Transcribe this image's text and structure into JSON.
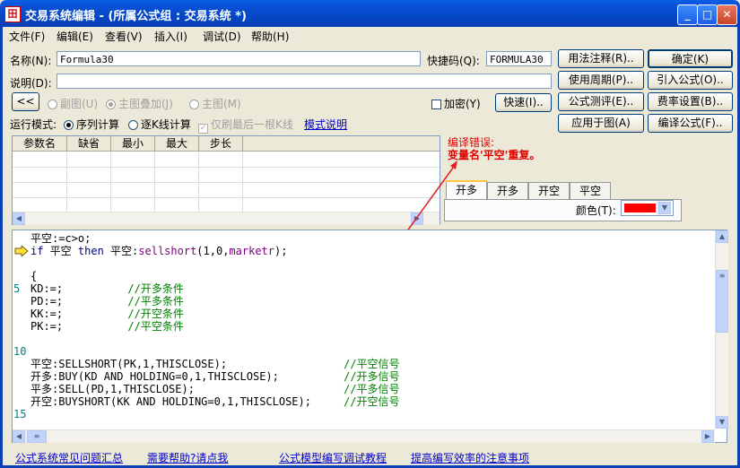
{
  "window": {
    "title": "交易系统编辑 - (所属公式组 : 交易系统 *)",
    "icon_glyph": "⽥"
  },
  "menu": [
    "文件(F)",
    "编辑(E)",
    "查看(V)",
    "插入(I)",
    "调试(D)",
    "帮助(H)"
  ],
  "form": {
    "name_label": "名称(N):",
    "name_value": "Formula30",
    "shortcut_label": "快捷码(Q):",
    "shortcut_value": "FORMULA30",
    "desc_label": "说明(D):",
    "desc_value": ""
  },
  "buttons": {
    "usage_note": "用法注释(R)..",
    "ok": "确定(K)",
    "use_period": "使用周期(P)..",
    "import_formula": "引入公式(O)..",
    "formula_test": "公式测评(E)..",
    "fee_setting": "费率设置(B)..",
    "apply_to_chart": "应用于图(A)",
    "encrypt_formula": "编译公式(F)..",
    "collapse": "<<",
    "quick": "快速(I).."
  },
  "chart_mode": {
    "sub_chart": "副图(U)",
    "main_overlay": "主图叠加(J)",
    "main_chart": "主图(M)"
  },
  "encrypt_label": "加密(Y)",
  "run_mode": {
    "label": "运行模式:",
    "sequence": "序列计算",
    "per_bar": "逐K线计算",
    "last_only": "仅刷最后一根K线",
    "mode_help": "模式说明"
  },
  "param_table": {
    "headers": [
      "参数名",
      "缺省",
      "最小",
      "最大",
      "步长"
    ]
  },
  "error": {
    "title": "编译错误:",
    "message": "变量名'平空'重复。"
  },
  "tabs": [
    "开多",
    "开多",
    "开空",
    "平空"
  ],
  "color_label": "颜色(T):",
  "color_value": "#ff0000",
  "code_lines": [
    {
      "ln": "",
      "text": "平空:=c>o;"
    },
    {
      "ln": "",
      "text": "if 平空 then 平空:sellshort(1,0,marketr);"
    },
    {
      "ln": "",
      "text": ""
    },
    {
      "ln": "",
      "text": "{"
    },
    {
      "ln": "5",
      "text": "KD:=;          //开多条件"
    },
    {
      "ln": "",
      "text": "PD:=;          //平多条件"
    },
    {
      "ln": "",
      "text": "KK:=;          //开空条件"
    },
    {
      "ln": "",
      "text": "PK:=;          //平空条件"
    },
    {
      "ln": "",
      "text": ""
    },
    {
      "ln": "10",
      "text": ""
    },
    {
      "ln": "",
      "text": "平空:SELLSHORT(PK,1,THISCLOSE);                  //平空信号"
    },
    {
      "ln": "",
      "text": "开多:BUY(KD AND HOLDING=0,1,THISCLOSE);          //开多信号"
    },
    {
      "ln": "",
      "text": "平多:SELL(PD,1,THISCLOSE);                       //平多信号"
    },
    {
      "ln": "",
      "text": "开空:BUYSHORT(KK AND HOLDING=0,1,THISCLOSE);     //开空信号"
    },
    {
      "ln": "15",
      "text": ""
    }
  ],
  "footer_links": [
    "公式系统常见问题汇总",
    "需要帮助?请点我",
    "公式模型编写调试教程",
    "提高编写效率的注意事项"
  ]
}
